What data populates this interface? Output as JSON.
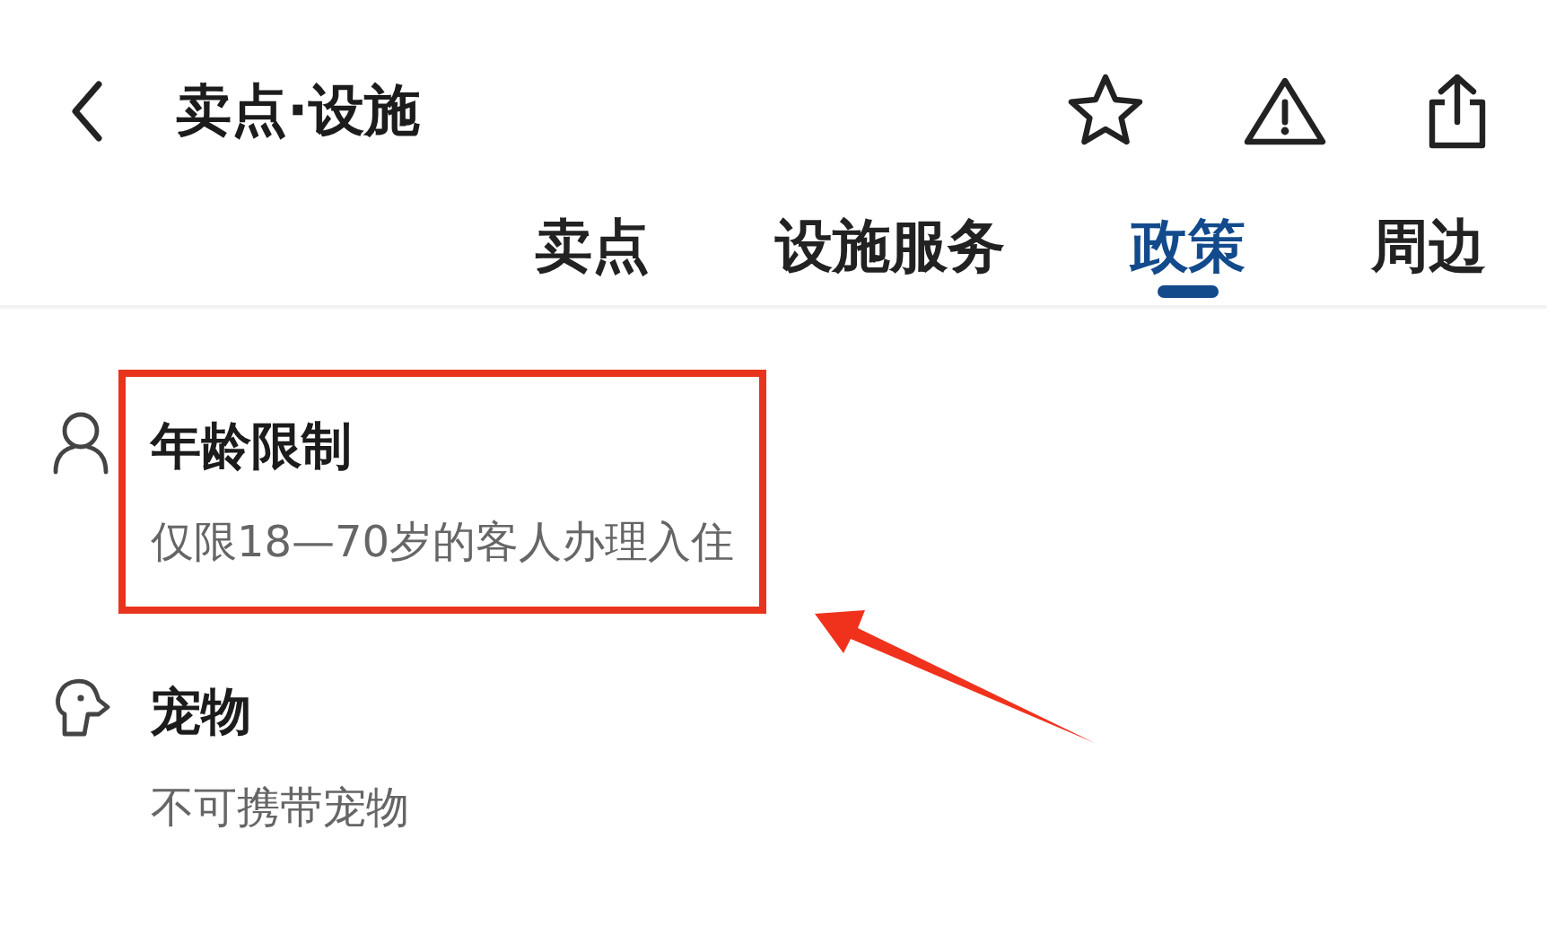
{
  "header": {
    "title": "卖点·设施"
  },
  "tabs": [
    {
      "label": "卖点",
      "selected": false
    },
    {
      "label": "设施服务",
      "selected": false
    },
    {
      "label": "政策",
      "selected": true
    },
    {
      "label": "周边",
      "selected": false
    }
  ],
  "policies": [
    {
      "kind": "person",
      "title": "年龄限制",
      "description": "仅限18—70岁的客人办理入住",
      "highlighted": true
    },
    {
      "kind": "pet",
      "title": "宠物",
      "description": "不可携带宠物",
      "highlighted": false
    }
  ]
}
